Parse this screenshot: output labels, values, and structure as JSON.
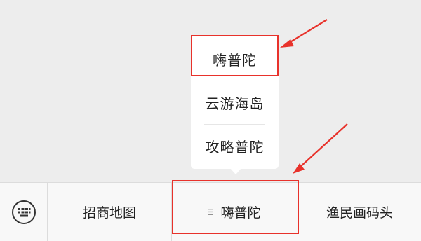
{
  "popup_menu": {
    "items": [
      {
        "label": "嗨普陀"
      },
      {
        "label": "云游海岛"
      },
      {
        "label": "攻略普陀"
      }
    ]
  },
  "bottom_menu": {
    "keyboard_icon": "keyboard-icon",
    "items": [
      {
        "label": "招商地图"
      },
      {
        "label": "嗨普陀",
        "icon": "submenu-icon"
      },
      {
        "label": "渔民画码头"
      }
    ]
  },
  "colors": {
    "highlight": "#e8322b",
    "background": "#ededed",
    "bar": "#f8f8f8"
  }
}
